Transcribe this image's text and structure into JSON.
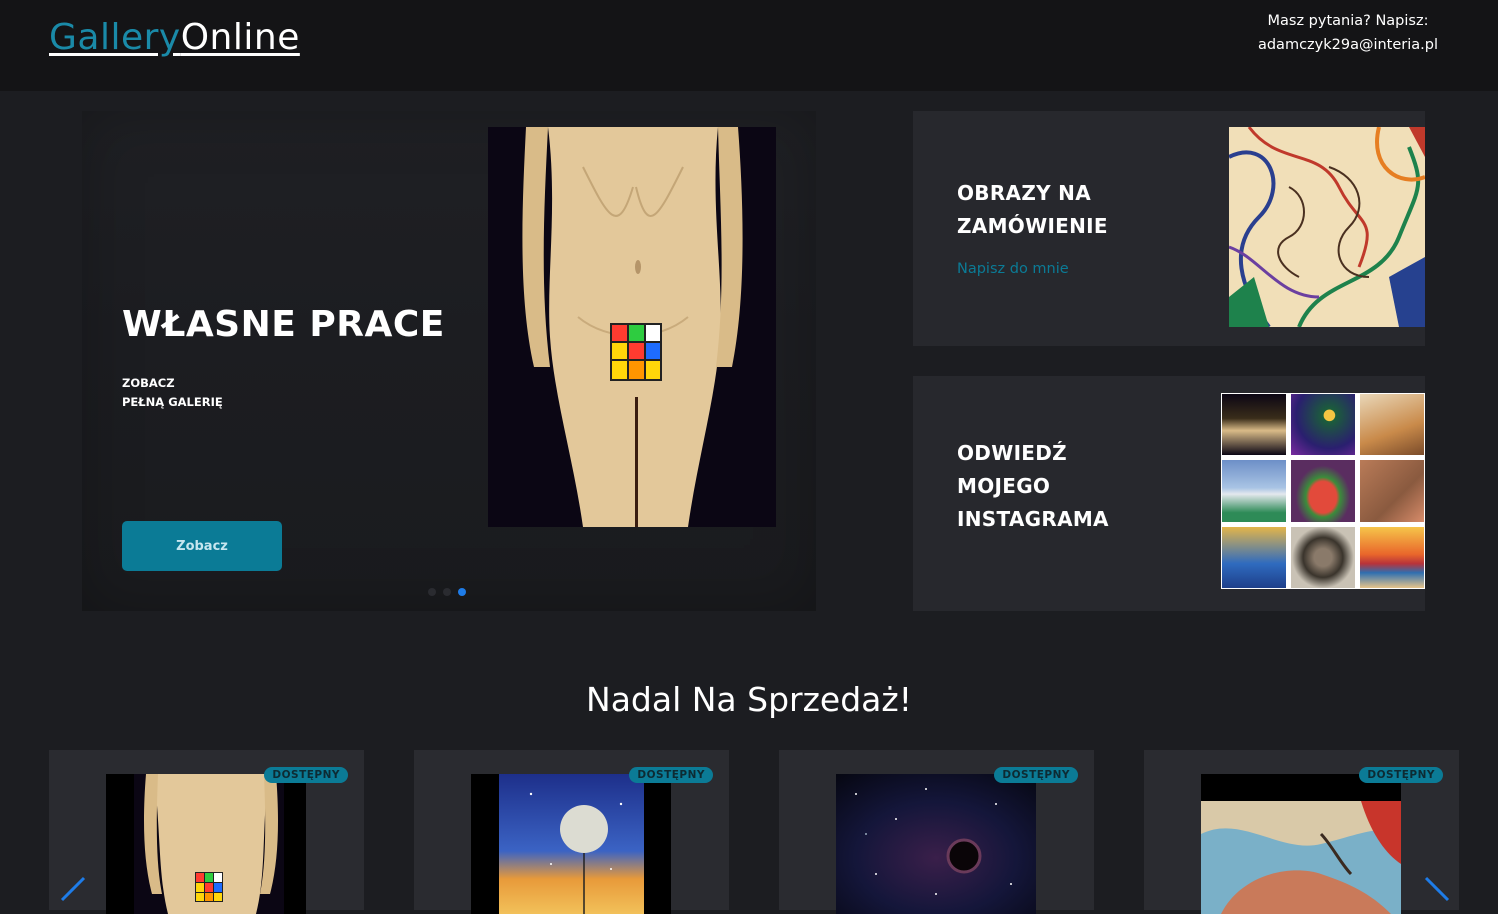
{
  "header": {
    "logo_part1": "Gallery",
    "logo_part2": "Online",
    "contact_line1": "Masz pytania? Napisz:",
    "contact_line2": "adamczyk29a@interia.pl"
  },
  "slider": {
    "title": "WŁASNE PRACE",
    "subtitle_line1": "ZOBACZ",
    "subtitle_line2": "PEŁNĄ GALERIĘ",
    "button_label": "Zobacz",
    "slide_count": 3,
    "active_slide": 3
  },
  "cards": {
    "orders": {
      "title_line1": "OBRAZY NA",
      "title_line2": "ZAMÓWIENIE",
      "link_label": "Napisz do mnie"
    },
    "instagram": {
      "title_line1": "ODWIEDŹ",
      "title_line2": "MOJEGO",
      "title_line3": "INSTAGRAMA"
    }
  },
  "section": {
    "title": "Nadal Na Sprzedaż!"
  },
  "products": [
    {
      "badge": "DOSTĘPNY"
    },
    {
      "badge": "DOSTĘPNY"
    },
    {
      "badge": "DOSTĘPNY"
    },
    {
      "badge": "DOSTĘPNY"
    }
  ],
  "colors": {
    "accent": "#0b7b96",
    "logo_accent": "#1a8aa8",
    "active_dot": "#1e7ce8",
    "page_bg": "#1c1d21",
    "header_bg": "#141416",
    "card_bg": "#27282d"
  }
}
